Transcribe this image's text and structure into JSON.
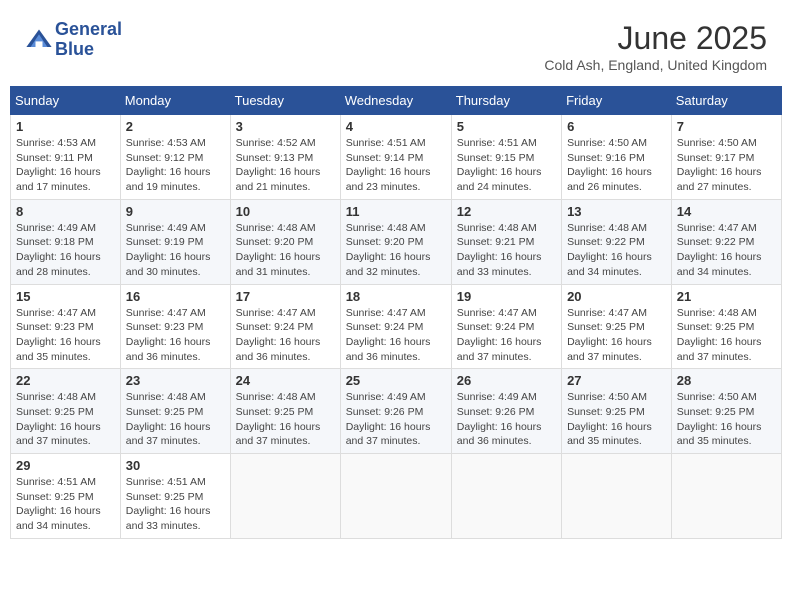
{
  "logo": {
    "line1": "General",
    "line2": "Blue"
  },
  "title": "June 2025",
  "subtitle": "Cold Ash, England, United Kingdom",
  "days_of_week": [
    "Sunday",
    "Monday",
    "Tuesday",
    "Wednesday",
    "Thursday",
    "Friday",
    "Saturday"
  ],
  "weeks": [
    [
      {
        "day": "1",
        "info": "Sunrise: 4:53 AM\nSunset: 9:11 PM\nDaylight: 16 hours\nand 17 minutes."
      },
      {
        "day": "2",
        "info": "Sunrise: 4:53 AM\nSunset: 9:12 PM\nDaylight: 16 hours\nand 19 minutes."
      },
      {
        "day": "3",
        "info": "Sunrise: 4:52 AM\nSunset: 9:13 PM\nDaylight: 16 hours\nand 21 minutes."
      },
      {
        "day": "4",
        "info": "Sunrise: 4:51 AM\nSunset: 9:14 PM\nDaylight: 16 hours\nand 23 minutes."
      },
      {
        "day": "5",
        "info": "Sunrise: 4:51 AM\nSunset: 9:15 PM\nDaylight: 16 hours\nand 24 minutes."
      },
      {
        "day": "6",
        "info": "Sunrise: 4:50 AM\nSunset: 9:16 PM\nDaylight: 16 hours\nand 26 minutes."
      },
      {
        "day": "7",
        "info": "Sunrise: 4:50 AM\nSunset: 9:17 PM\nDaylight: 16 hours\nand 27 minutes."
      }
    ],
    [
      {
        "day": "8",
        "info": "Sunrise: 4:49 AM\nSunset: 9:18 PM\nDaylight: 16 hours\nand 28 minutes."
      },
      {
        "day": "9",
        "info": "Sunrise: 4:49 AM\nSunset: 9:19 PM\nDaylight: 16 hours\nand 30 minutes."
      },
      {
        "day": "10",
        "info": "Sunrise: 4:48 AM\nSunset: 9:20 PM\nDaylight: 16 hours\nand 31 minutes."
      },
      {
        "day": "11",
        "info": "Sunrise: 4:48 AM\nSunset: 9:20 PM\nDaylight: 16 hours\nand 32 minutes."
      },
      {
        "day": "12",
        "info": "Sunrise: 4:48 AM\nSunset: 9:21 PM\nDaylight: 16 hours\nand 33 minutes."
      },
      {
        "day": "13",
        "info": "Sunrise: 4:48 AM\nSunset: 9:22 PM\nDaylight: 16 hours\nand 34 minutes."
      },
      {
        "day": "14",
        "info": "Sunrise: 4:47 AM\nSunset: 9:22 PM\nDaylight: 16 hours\nand 34 minutes."
      }
    ],
    [
      {
        "day": "15",
        "info": "Sunrise: 4:47 AM\nSunset: 9:23 PM\nDaylight: 16 hours\nand 35 minutes."
      },
      {
        "day": "16",
        "info": "Sunrise: 4:47 AM\nSunset: 9:23 PM\nDaylight: 16 hours\nand 36 minutes."
      },
      {
        "day": "17",
        "info": "Sunrise: 4:47 AM\nSunset: 9:24 PM\nDaylight: 16 hours\nand 36 minutes."
      },
      {
        "day": "18",
        "info": "Sunrise: 4:47 AM\nSunset: 9:24 PM\nDaylight: 16 hours\nand 36 minutes."
      },
      {
        "day": "19",
        "info": "Sunrise: 4:47 AM\nSunset: 9:24 PM\nDaylight: 16 hours\nand 37 minutes."
      },
      {
        "day": "20",
        "info": "Sunrise: 4:47 AM\nSunset: 9:25 PM\nDaylight: 16 hours\nand 37 minutes."
      },
      {
        "day": "21",
        "info": "Sunrise: 4:48 AM\nSunset: 9:25 PM\nDaylight: 16 hours\nand 37 minutes."
      }
    ],
    [
      {
        "day": "22",
        "info": "Sunrise: 4:48 AM\nSunset: 9:25 PM\nDaylight: 16 hours\nand 37 minutes."
      },
      {
        "day": "23",
        "info": "Sunrise: 4:48 AM\nSunset: 9:25 PM\nDaylight: 16 hours\nand 37 minutes."
      },
      {
        "day": "24",
        "info": "Sunrise: 4:48 AM\nSunset: 9:25 PM\nDaylight: 16 hours\nand 37 minutes."
      },
      {
        "day": "25",
        "info": "Sunrise: 4:49 AM\nSunset: 9:26 PM\nDaylight: 16 hours\nand 37 minutes."
      },
      {
        "day": "26",
        "info": "Sunrise: 4:49 AM\nSunset: 9:26 PM\nDaylight: 16 hours\nand 36 minutes."
      },
      {
        "day": "27",
        "info": "Sunrise: 4:50 AM\nSunset: 9:25 PM\nDaylight: 16 hours\nand 35 minutes."
      },
      {
        "day": "28",
        "info": "Sunrise: 4:50 AM\nSunset: 9:25 PM\nDaylight: 16 hours\nand 35 minutes."
      }
    ],
    [
      {
        "day": "29",
        "info": "Sunrise: 4:51 AM\nSunset: 9:25 PM\nDaylight: 16 hours\nand 34 minutes."
      },
      {
        "day": "30",
        "info": "Sunrise: 4:51 AM\nSunset: 9:25 PM\nDaylight: 16 hours\nand 33 minutes."
      },
      {
        "day": "",
        "info": ""
      },
      {
        "day": "",
        "info": ""
      },
      {
        "day": "",
        "info": ""
      },
      {
        "day": "",
        "info": ""
      },
      {
        "day": "",
        "info": ""
      }
    ]
  ]
}
